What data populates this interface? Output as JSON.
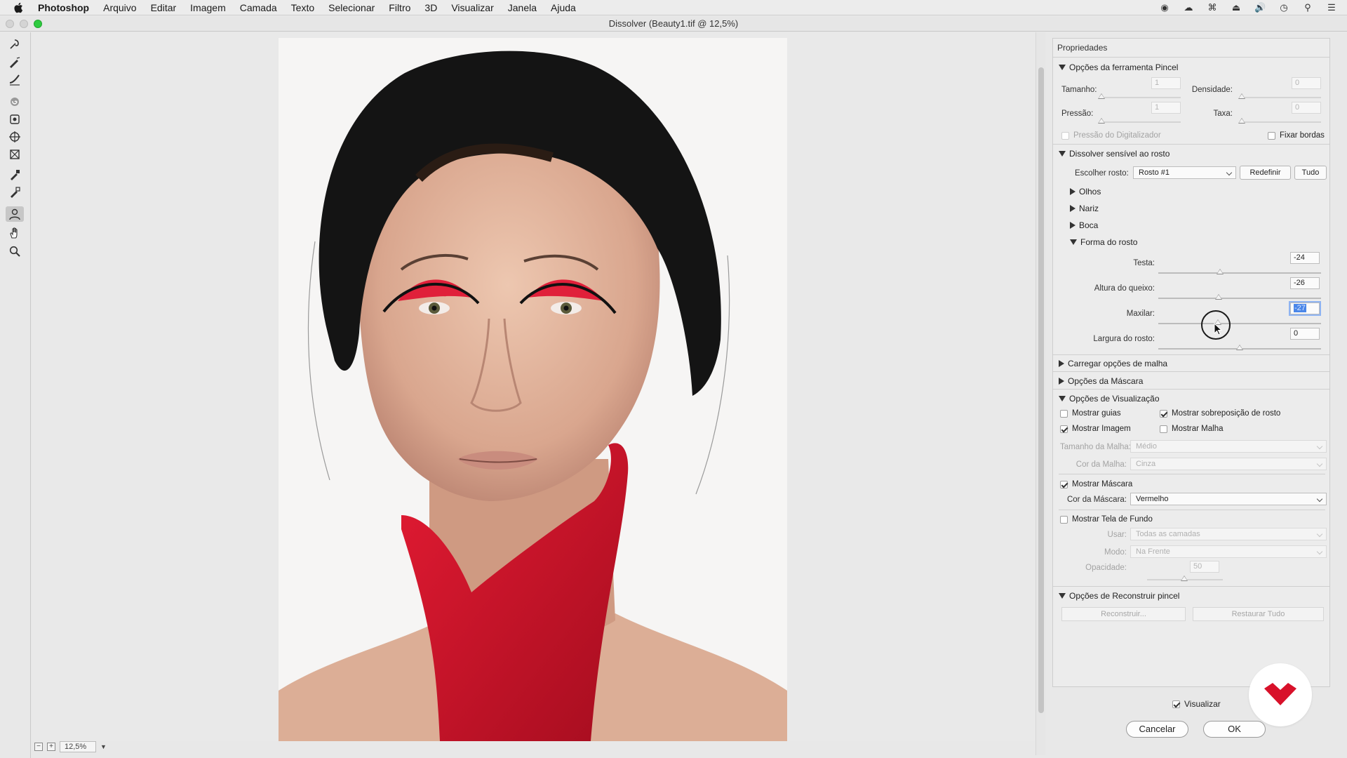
{
  "menubar": {
    "app": "Photoshop",
    "items": [
      "Arquivo",
      "Editar",
      "Imagem",
      "Camada",
      "Texto",
      "Selecionar",
      "Filtro",
      "3D",
      "Visualizar",
      "Janela",
      "Ajuda"
    ]
  },
  "window": {
    "title": "Dissolver (Beauty1.tif @ 12,5%)"
  },
  "statusbar": {
    "zoom": "12,5%"
  },
  "panel": {
    "title": "Propriedades",
    "brush": {
      "header": "Opções da ferramenta Pincel",
      "size_label": "Tamanho:",
      "size_value": "1",
      "density_label": "Densidade:",
      "density_value": "0",
      "pressure_label": "Pressão:",
      "pressure_value": "1",
      "rate_label": "Taxa:",
      "rate_value": "0",
      "stylus_label": "Pressão do Digitalizador",
      "pin_edges_label": "Fixar bordas"
    },
    "face": {
      "header": "Dissolver sensível ao rosto",
      "select_label": "Escolher rosto:",
      "select_value": "Rosto #1",
      "reset_label": "Redefinir",
      "all_label": "Tudo",
      "eyes": "Olhos",
      "nose": "Nariz",
      "mouth": "Boca",
      "shape": "Forma do rosto",
      "forehead_label": "Testa:",
      "forehead_value": "-24",
      "chin_label": "Altura do queixo:",
      "chin_value": "-26",
      "jaw_label": "Maxilar:",
      "jaw_value": "-27",
      "width_label": "Largura do rosto:",
      "width_value": "0"
    },
    "load_mesh": "Carregar opções de malha",
    "mask_options": "Opções da Máscara",
    "view": {
      "header": "Opções de Visualização",
      "show_guides": "Mostrar guias",
      "show_face_overlay": "Mostrar sobreposição de rosto",
      "show_image": "Mostrar Imagem",
      "show_mesh": "Mostrar Malha",
      "mesh_size_label": "Tamanho da Malha:",
      "mesh_size_value": "Médio",
      "mesh_color_label": "Cor da Malha:",
      "mesh_color_value": "Cinza",
      "show_mask": "Mostrar Máscara",
      "mask_color_label": "Cor da Máscara:",
      "mask_color_value": "Vermelho",
      "show_backdrop": "Mostrar Tela de Fundo",
      "use_label": "Usar:",
      "use_value": "Todas as camadas",
      "mode_label": "Modo:",
      "mode_value": "Na Frente",
      "opacity_label": "Opacidade:",
      "opacity_value": "50"
    },
    "reconstruct": {
      "header": "Opções de Reconstruir pincel",
      "reconstruct_btn": "Reconstruir...",
      "restore_btn": "Restaurar Tudo"
    }
  },
  "footer": {
    "preview_label": "Visualizar",
    "cancel_label": "Cancelar",
    "ok_label": "OK"
  },
  "sliders": {
    "forehead": -24,
    "chin": -26,
    "jaw": -27,
    "face_width": 0,
    "range": [
      -100,
      100
    ]
  },
  "colors": {
    "accent": "#4a86e8",
    "mask": "#d8112a",
    "window_green": "#2ecb3f"
  },
  "icons": [
    "apple-icon",
    "forward-warp-icon",
    "reconstruct-icon",
    "smooth-icon",
    "twirl-icon",
    "pucker-icon",
    "bloat-icon",
    "push-left-icon",
    "freeze-mask-icon",
    "thaw-mask-icon",
    "face-tool-icon",
    "hand-icon",
    "zoom-icon",
    "logo-icon"
  ]
}
